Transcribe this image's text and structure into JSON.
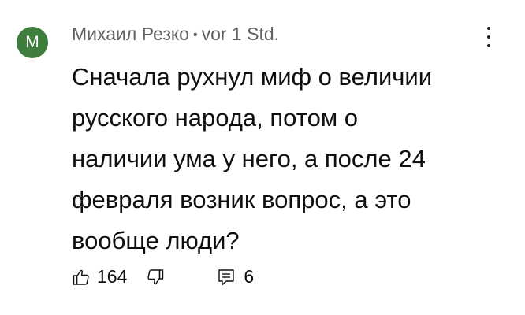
{
  "comment": {
    "author_initial": "М",
    "author_name": "Михаил Резко",
    "separator": "•",
    "time_ago": "vor 1 Std.",
    "text": "Сначала рухнул миф о величии\nрусского народа, потом о\nналичии ума  у него, а после 24\nфевраля возник вопрос, а это\nвообще люди?",
    "like_count": "164",
    "reply_count": "6"
  },
  "colors": {
    "avatar_bg": "#3f7d3c",
    "meta_text": "#606060",
    "body_text": "#0f0f0f"
  },
  "icons": [
    "thumbs-up-icon",
    "thumbs-down-icon",
    "reply-comment-icon",
    "more-vertical-icon"
  ]
}
